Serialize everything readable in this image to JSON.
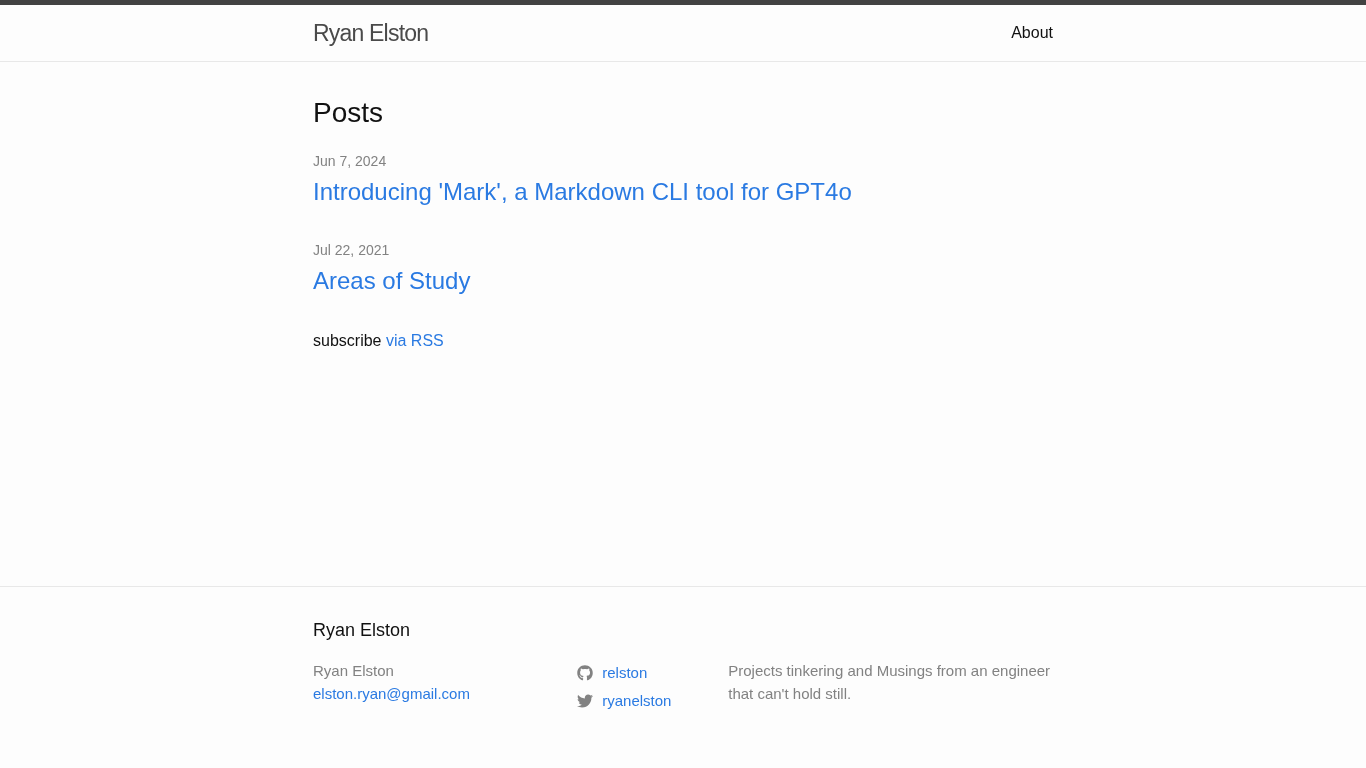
{
  "header": {
    "site_title": "Ryan Elston",
    "nav": [
      {
        "label": "About"
      }
    ]
  },
  "page_heading": "Posts",
  "posts": [
    {
      "date": "Jun 7, 2024",
      "title": "Introducing 'Mark', a Markdown CLI tool for GPT4o"
    },
    {
      "date": "Jul 22, 2021",
      "title": "Areas of Study"
    }
  ],
  "rss": {
    "text": "subscribe",
    "link": "via RSS"
  },
  "footer": {
    "heading": "Ryan Elston",
    "name": "Ryan Elston",
    "email": "elston.ryan@gmail.com",
    "social": [
      {
        "kind": "github",
        "handle": "relston"
      },
      {
        "kind": "twitter",
        "handle": "ryanelston"
      }
    ],
    "description": "Projects tinkering and Musings from an engineer that can't hold still."
  }
}
